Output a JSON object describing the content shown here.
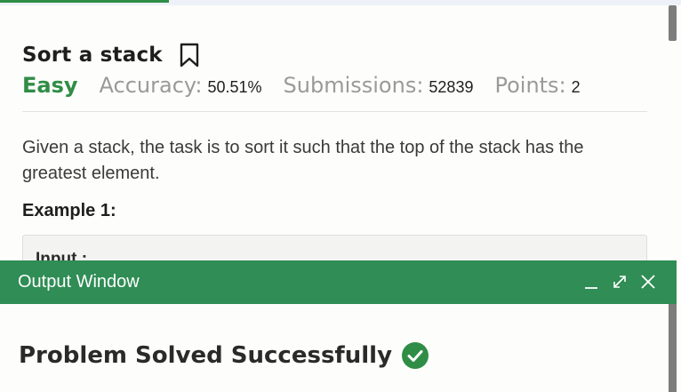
{
  "problem": {
    "title": "Sort a stack",
    "difficulty": "Easy",
    "accuracy_label": "Accuracy:",
    "accuracy_value": "50.51%",
    "submissions_label": "Submissions:",
    "submissions_value": "52839",
    "points_label": "Points:",
    "points_value": "2",
    "description": "Given a stack, the task is to sort it such that the top of the stack has the greatest element.",
    "example_heading": "Example 1:",
    "example_input_label": "Input :"
  },
  "output_window": {
    "title": "Output Window",
    "result": "Problem Solved Successfully"
  },
  "colors": {
    "accent_green": "#2f8d46",
    "header_green": "#2f8d55",
    "muted_text": "#9a9a9a"
  },
  "icons": {
    "bookmark": "bookmark-icon",
    "minimize": "minimize-icon",
    "expand": "expand-icon",
    "close": "close-icon",
    "success": "check-circle-icon"
  }
}
